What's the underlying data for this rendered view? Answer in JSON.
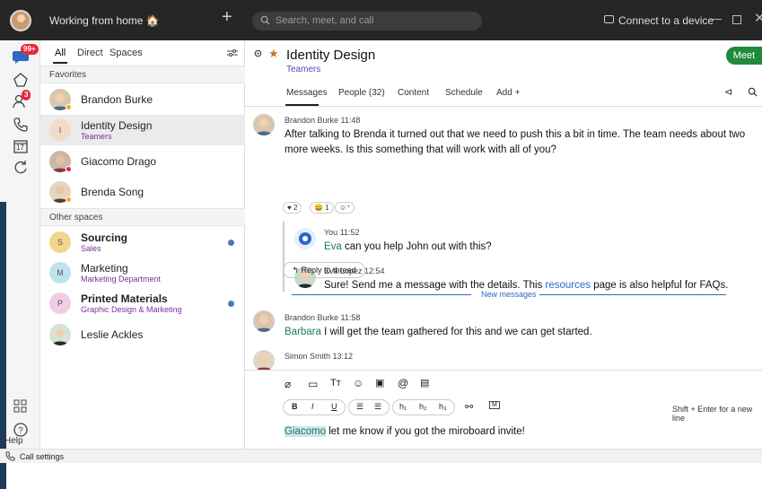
{
  "titlebar": {
    "status": "Working from home 🏠",
    "search_placeholder": "Search, meet, and call",
    "connect_label": "Connect to a device"
  },
  "rail": {
    "messaging_badge": "99+",
    "calls_badge": "3",
    "calendar_day": "17",
    "help_label": "Help"
  },
  "sidebar": {
    "tabs": [
      "All",
      "Direct",
      "Spaces"
    ],
    "favorites_label": "Favorites",
    "other_label": "Other spaces",
    "favorites": [
      {
        "name": "Brandon Burke",
        "sub": ""
      },
      {
        "name": "Identity Design",
        "sub": "Teamers",
        "letter": "I"
      },
      {
        "name": "Giacomo Drago",
        "sub": ""
      },
      {
        "name": "Brenda Song",
        "sub": ""
      }
    ],
    "others": [
      {
        "name": "Sourcing",
        "sub": "Sales",
        "letter": "S"
      },
      {
        "name": "Marketing",
        "sub": "Marketing Department",
        "letter": "M"
      },
      {
        "name": "Printed Materials",
        "sub": "Graphic Design & Marketing",
        "letter": "P"
      },
      {
        "name": "Leslie Ackles",
        "sub": ""
      }
    ]
  },
  "space": {
    "title": "Identity Design",
    "team": "Teamers",
    "meet_label": "Meet",
    "tabs": [
      "Messages",
      "People (32)",
      "Content",
      "Schedule",
      "Add  +"
    ]
  },
  "messages": {
    "m1_meta": "Brandon Burke   11:48",
    "m1_text": "After talking to Brenda it turned out that we need to push this a bit in time. The team needs about two more weeks. Is this something that will work with all of you?",
    "reactions": [
      "♥ 2",
      "😀 1"
    ],
    "r1_meta": "You   11:52",
    "r1_mention": "Eva",
    "r1_text": " can you help John out with this?",
    "r2_meta": "Eva Lopez   12:54",
    "r2_text_a": "Sure! Send me a message with the details. This ",
    "r2_link": "resources",
    "r2_text_b": " page is also helpful for FAQs.",
    "reply_label": "Reply to thread",
    "new_label": "New messages",
    "m2_meta": "Brandon Burke   11:58",
    "m2_mention": "Barbara",
    "m2_text": " I will get the team gathered for this and we can get started.",
    "m3_meta": "Simon Smith   13:12"
  },
  "composer": {
    "hint": "Shift + Enter for a new line",
    "draft_mention": "Giacomo",
    "draft_text": " let me know if you got the miroboard invite!",
    "format_buttons": [
      "B",
      "I",
      "U",
      "h₁",
      "h₂",
      "h₃"
    ]
  },
  "bottombar": {
    "call_settings": "Call settings"
  }
}
